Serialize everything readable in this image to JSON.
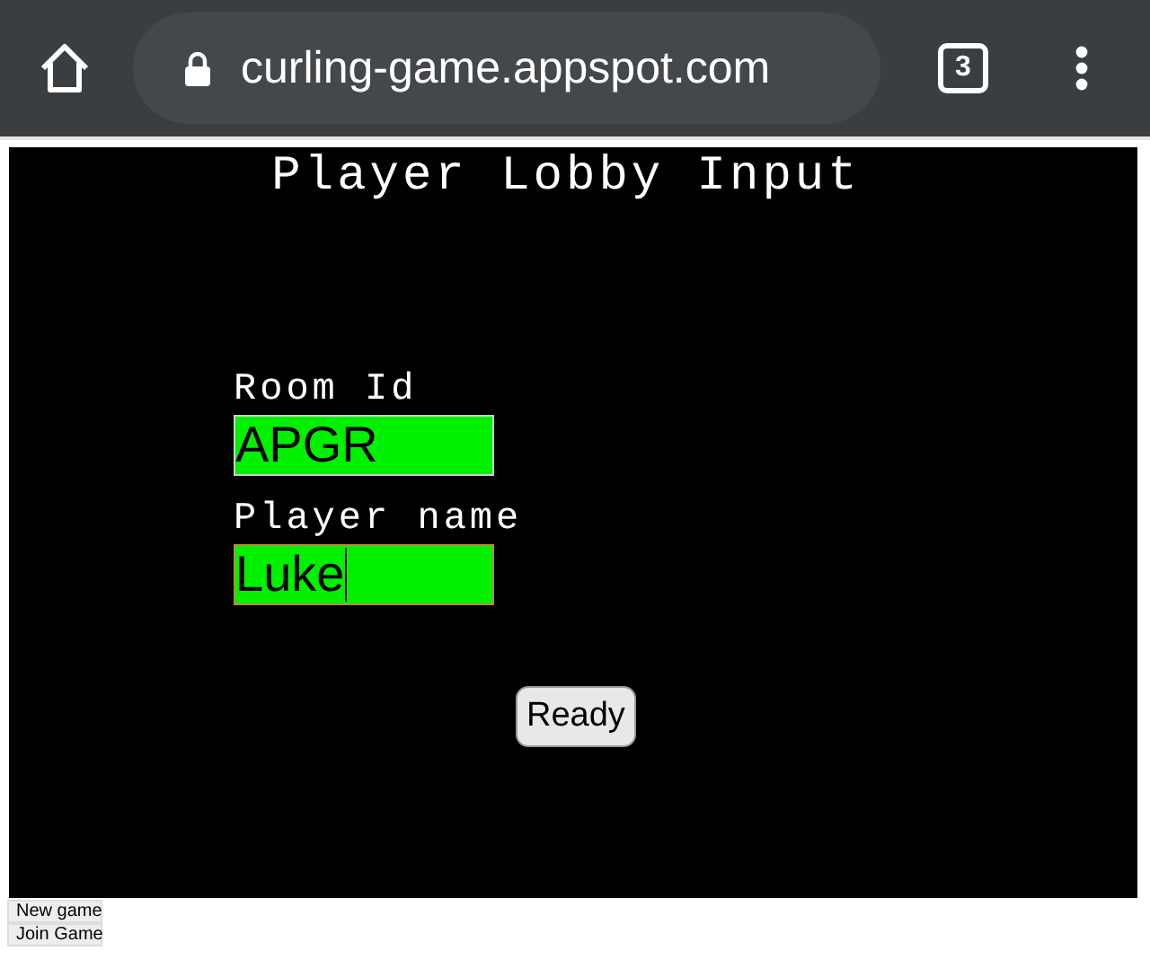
{
  "browser": {
    "url": "curling-game.appspot.com",
    "tab_count": "3"
  },
  "lobby": {
    "title": "Player Lobby Input",
    "fields": [
      {
        "label": "Room Id",
        "value": "APGR",
        "focused": false
      },
      {
        "label": "Player name",
        "value": "Luke",
        "focused": true
      }
    ],
    "ready_button": "Ready"
  },
  "buttons": [
    "New game",
    "Join Game"
  ]
}
